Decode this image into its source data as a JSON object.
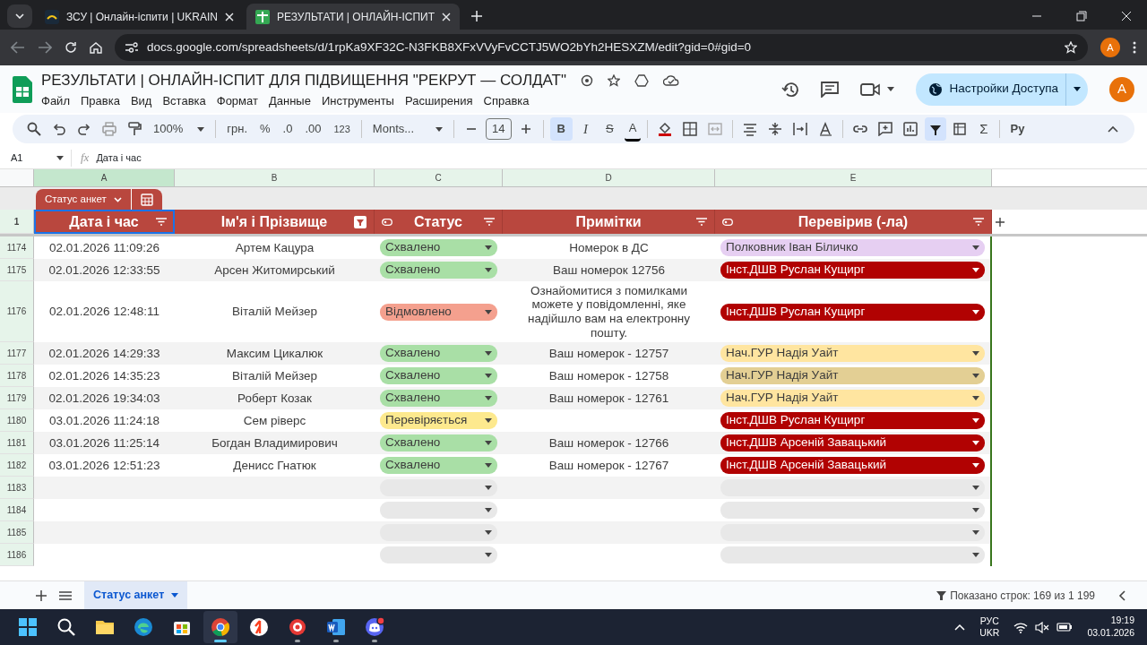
{
  "browser": {
    "tabs": [
      {
        "title": "ЗСУ | Онлайн-іспити | UKRAIN",
        "selected": false
      },
      {
        "title": "РЕЗУЛЬТАТИ | ОНЛАЙН-ІСПИТ",
        "selected": true
      }
    ],
    "url": "docs.google.com/spreadsheets/d/1rpKa9XF32C-N3FKB8XFxVVyFvCCTJ5WO2bYh2HESXZM/edit?gid=0#gid=0",
    "profile": "A"
  },
  "doc": {
    "title": "РЕЗУЛЬТАТИ | ОНЛАЙН-ІСПИТ ДЛЯ ПІДВИЩЕННЯ \"РЕКРУТ — СОЛДАТ\"",
    "menus": [
      "Файл",
      "Правка",
      "Вид",
      "Вставка",
      "Формат",
      "Данные",
      "Инструменты",
      "Расширения",
      "Справка"
    ],
    "share": "Настройки Доступа",
    "avatar": "А"
  },
  "toolbar": {
    "zoom": "100%",
    "currency": "грн.",
    "percent": "%",
    "decrease_decimals": ".0",
    "increase_decimals": ".00",
    "number_format": "123",
    "font": "Monts...",
    "font_size": "14",
    "bold": {
      "label": "B",
      "on": true
    },
    "italic": {
      "label": "I",
      "on": false
    },
    "strike": {
      "label": "S",
      "on": false
    },
    "text_color": "A",
    "filter_on": true,
    "sum": "Σ",
    "input_tools": "Ру"
  },
  "formula_bar": {
    "cell": "A1",
    "fx": "fx",
    "value": "Дата і час"
  },
  "columns": [
    {
      "letter": "A",
      "selected": true
    },
    {
      "letter": "B",
      "selected": false
    },
    {
      "letter": "C",
      "selected": false
    },
    {
      "letter": "D",
      "selected": false
    },
    {
      "letter": "E",
      "selected": false
    }
  ],
  "filter_view": {
    "label": "Статус анкет"
  },
  "header": {
    "row": "1",
    "cells": [
      {
        "title": "Дата і час",
        "chip_column": false,
        "filter_active": false
      },
      {
        "title": "Ім'я і Прізвище",
        "chip_column": false,
        "filter_active": true
      },
      {
        "title": "Статус",
        "chip_column": true,
        "filter_active": false
      },
      {
        "title": "Примітки",
        "chip_column": false,
        "filter_active": false
      },
      {
        "title": "Перевірив (-ла)",
        "chip_column": true,
        "filter_active": false
      }
    ]
  },
  "rows": [
    {
      "row": "1174",
      "datetime": "02.01.2026 11:09:26",
      "name": "Артем Кацура",
      "status": {
        "text": "Схвалено",
        "color": "#a9dfa6"
      },
      "note": "Номерок в ДС",
      "checker": {
        "text": "Полковник Іван Біличко",
        "color": "#e6cff2"
      }
    },
    {
      "row": "1175",
      "datetime": "02.01.2026 12:33:55",
      "name": "Арсен Житомирський",
      "status": {
        "text": "Схвалено",
        "color": "#a9dfa6"
      },
      "note": "Ваш номерок 12756",
      "checker": {
        "text": "Інст.ДШВ Руслан Кущирг",
        "color": "#b10202"
      }
    },
    {
      "row": "1176",
      "datetime": "02.01.2026 12:48:11",
      "name": "Віталій Мейзер",
      "status": {
        "text": "Відмовлено",
        "color": "#f4a08e"
      },
      "note": "Ознайомитися з помилками можете у повідомленні, яке надійшло вам на електронну пошту.",
      "checker": {
        "text": "Інст.ДШВ Руслан Кущирг",
        "color": "#b10202"
      }
    },
    {
      "row": "1177",
      "datetime": "02.01.2026 14:29:33",
      "name": "Максим Цикалюк",
      "status": {
        "text": "Схвалено",
        "color": "#a9dfa6"
      },
      "note": "Ваш номерок - 12757",
      "checker": {
        "text": "Нач.ГУР Надія Уайт",
        "color": "#ffe5a0"
      }
    },
    {
      "row": "1178",
      "datetime": "02.01.2026 14:35:23",
      "name": "Віталій Мейзер",
      "status": {
        "text": "Схвалено",
        "color": "#a9dfa6"
      },
      "note": "Ваш номерок - 12758",
      "checker": {
        "text": "Нач.ГУР Надія Уайт",
        "color": "#e3cf94"
      }
    },
    {
      "row": "1179",
      "datetime": "02.01.2026 19:34:03",
      "name": "Роберт Козак",
      "status": {
        "text": "Схвалено",
        "color": "#a9dfa6"
      },
      "note": "Ваш номерок - 12761",
      "checker": {
        "text": "Нач.ГУР Надія Уайт",
        "color": "#ffe5a0"
      }
    },
    {
      "row": "1180",
      "datetime": "03.01.2026 11:24:18",
      "name": "Сем ріверс",
      "status": {
        "text": "Перевіряється",
        "color": "#fde98e"
      },
      "checker": {
        "text": "Інст.ДШВ Руслан Кущирг",
        "color": "#b10202"
      }
    },
    {
      "row": "1181",
      "datetime": "03.01.2026 11:25:14",
      "name": "Богдан Владимирович",
      "status": {
        "text": "Схвалено",
        "color": "#a9dfa6"
      },
      "note": "Ваш номерок - 12766",
      "checker": {
        "text": "Інст.ДШВ Арсеній Завацький",
        "color": "#b10202"
      }
    },
    {
      "row": "1182",
      "datetime": "03.01.2026 12:51:23",
      "name": "Денисс Гнатюк",
      "status": {
        "text": "Схвалено",
        "color": "#a9dfa6"
      },
      "note": "Ваш номерок - 12767",
      "checker": {
        "text": "Інст.ДШВ Арсеній Завацький",
        "color": "#b10202"
      }
    },
    {
      "row": "1183",
      "status": {
        "color": "#e8e8e8"
      },
      "checker": {
        "color": "#e8e8e8"
      }
    },
    {
      "row": "1184",
      "status": {
        "color": "#e8e8e8"
      },
      "checker": {
        "color": "#e8e8e8"
      }
    },
    {
      "row": "1185",
      "status": {
        "color": "#e8e8e8"
      },
      "checker": {
        "color": "#e8e8e8"
      }
    },
    {
      "row": "1186",
      "status": {
        "color": "#e8e8e8"
      },
      "checker": {
        "color": "#e8e8e8"
      }
    }
  ],
  "sheet_tabs": [
    {
      "label": "Статус анкет",
      "selected": true
    }
  ],
  "status": "Показано строк: 169 из 1 199",
  "taskbar": {
    "apps": [
      {
        "kind": "start",
        "running": false,
        "active": false
      },
      {
        "kind": "search",
        "running": false,
        "active": false
      },
      {
        "kind": "folder",
        "running": false,
        "active": false
      },
      {
        "kind": "edge",
        "running": false,
        "active": false
      },
      {
        "kind": "store",
        "running": false,
        "active": false
      },
      {
        "kind": "chrome",
        "running": true,
        "active": true
      },
      {
        "kind": "yandex",
        "running": false,
        "active": false
      },
      {
        "kind": "redapp",
        "running": true,
        "active": false
      },
      {
        "kind": "word",
        "running": true,
        "active": false
      },
      {
        "kind": "discord",
        "running": true,
        "active": false
      }
    ],
    "lang": "РУС",
    "layout": "UKR",
    "time": "19:19",
    "date": "03.01.2026"
  }
}
